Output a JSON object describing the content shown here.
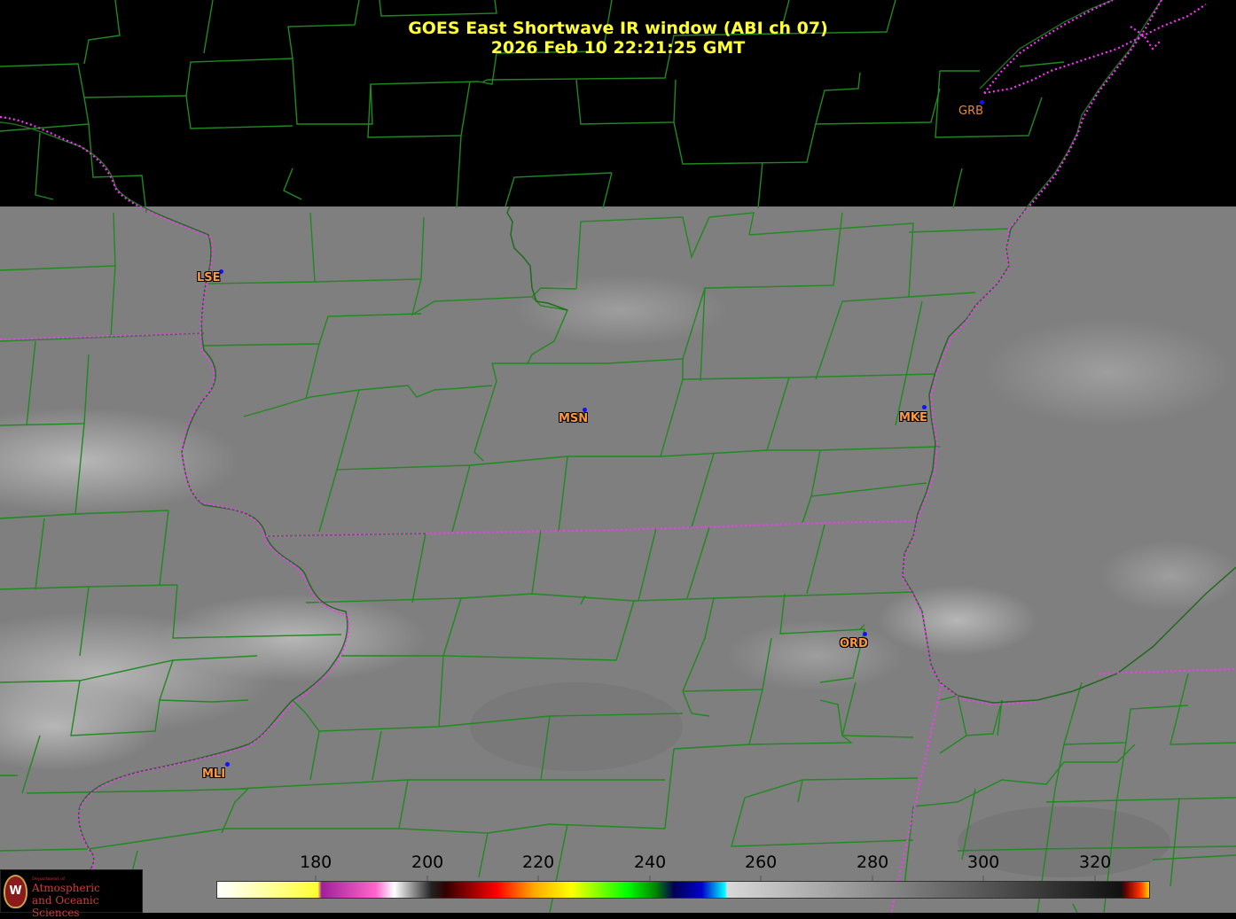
{
  "title": {
    "line1": "GOES East Shortwave IR window (ABI ch 07)",
    "line2": "2026 Feb 10  22:21:25 GMT"
  },
  "cities": [
    {
      "code": "GRB"
    },
    {
      "code": "LSE"
    },
    {
      "code": "MSN"
    },
    {
      "code": "MKE"
    },
    {
      "code": "ORD"
    },
    {
      "code": "MLI"
    }
  ],
  "colorbar": {
    "range": [
      170,
      330
    ],
    "ticks": [
      "180",
      "200",
      "220",
      "240",
      "260",
      "280",
      "300",
      "320"
    ]
  },
  "logo": {
    "seal": "W",
    "small": "Department of",
    "line1": "Atmospheric",
    "line2": "and Oceanic Sciences"
  },
  "colors": {
    "background": "#000000",
    "imagery": "#7f7f7f",
    "county_lines": "#1f8a1f",
    "state_lines": "#ff33ff",
    "title": "#ffff33",
    "city_label": "#ff9a3c",
    "city_dot": "#1010ff"
  }
}
